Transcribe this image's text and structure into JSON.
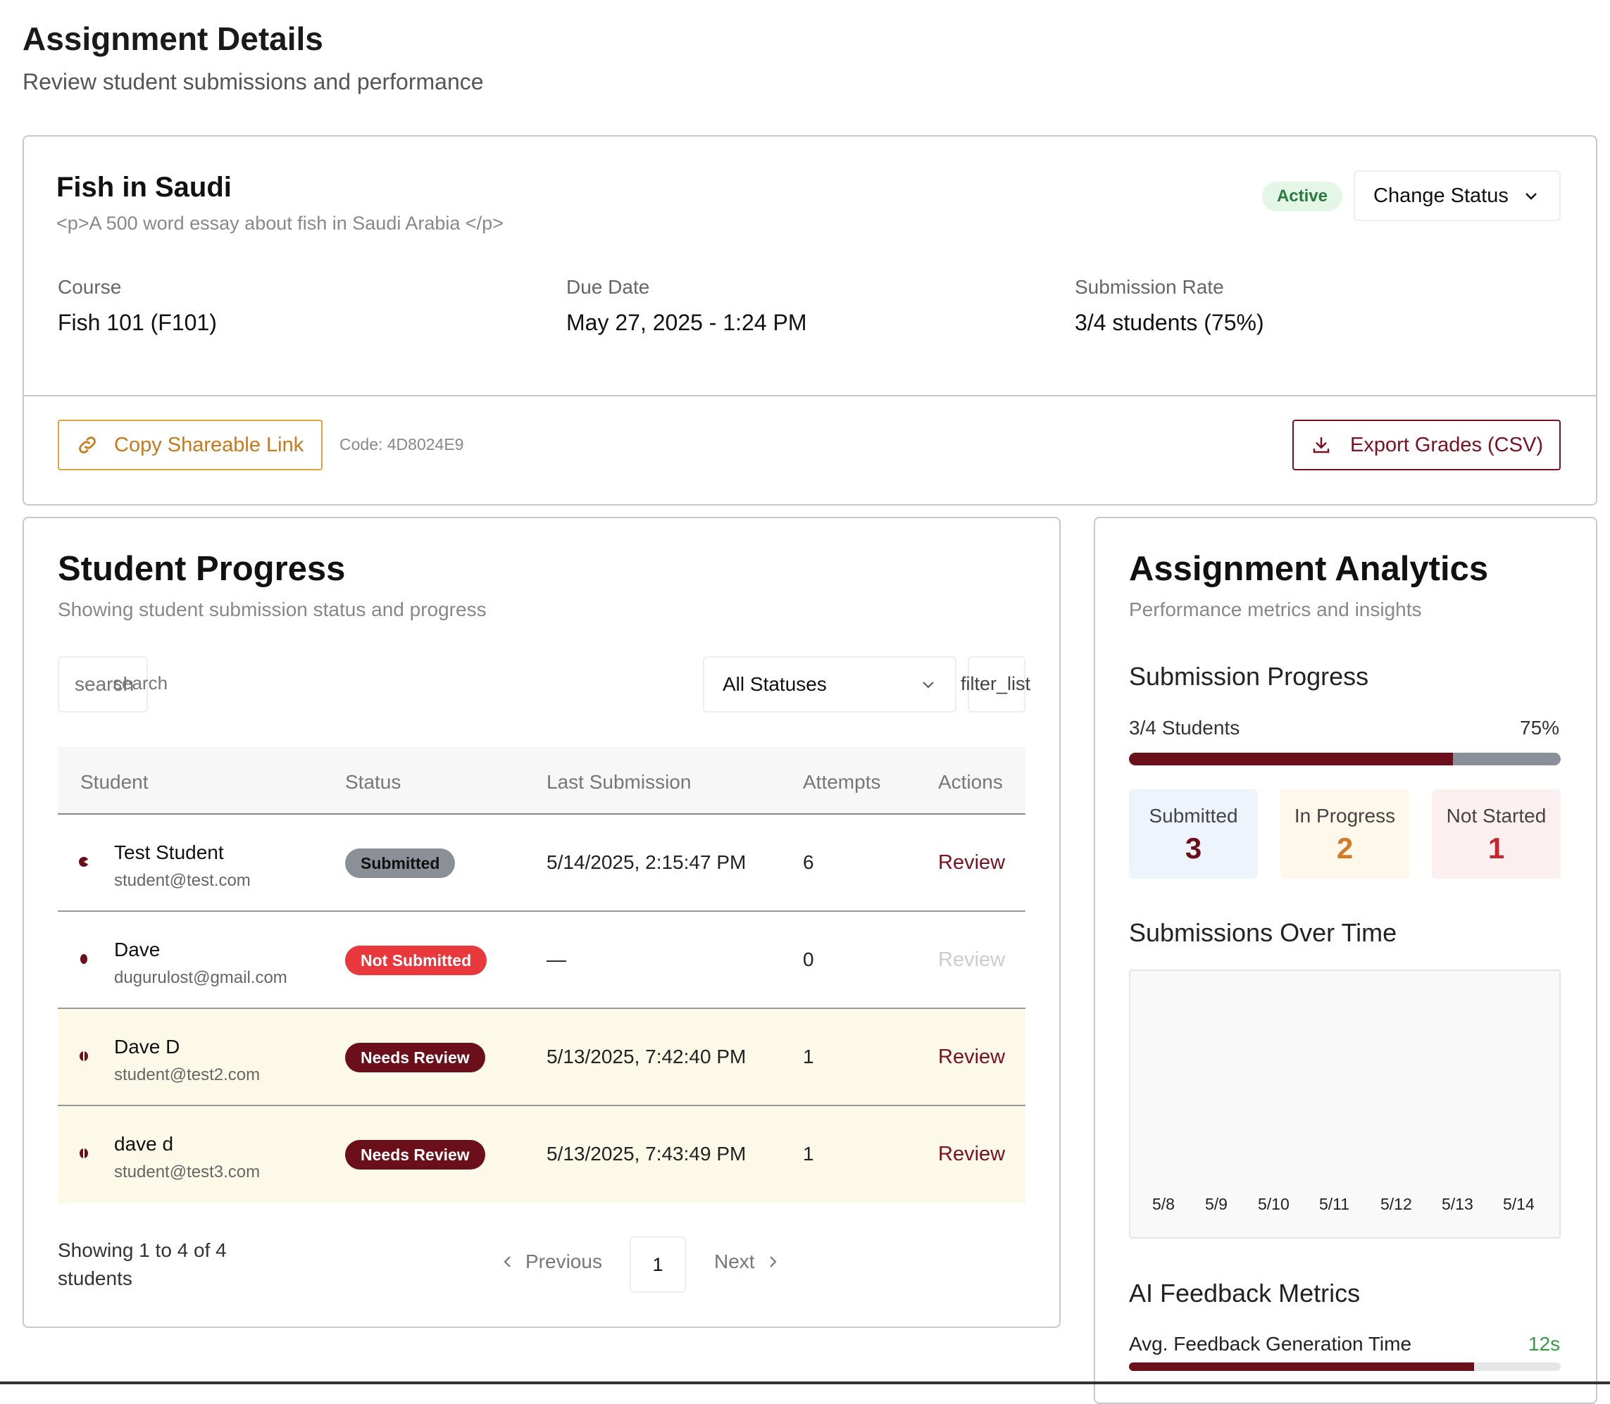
{
  "header": {
    "title": "Assignment Details",
    "subtitle": "Review student submissions and performance"
  },
  "assignment": {
    "title": "Fish in Saudi",
    "description": "<p>A 500 word essay about fish in Saudi Arabia </p>",
    "status_badge": "Active",
    "status_badge_color": "#2b7a3e",
    "change_status_label": "Change Status",
    "course_label": "Course",
    "course_value": "Fish 101 (F101)",
    "due_label": "Due Date",
    "due_value": "May 27, 2025 - 1:24 PM",
    "rate_label": "Submission Rate",
    "rate_value": "3/4 students (75%)",
    "copy_link_label": "Copy Shareable Link",
    "code_text": "Code: 4D8024E9",
    "export_label": "Export Grades (CSV)"
  },
  "progress": {
    "title": "Student Progress",
    "subtitle": "Showing student submission status and progress",
    "search_placeholder": "search",
    "search_icon_text": "search",
    "status_filter_value": "All Statuses",
    "filter_icon_text": "filter_list",
    "columns": [
      "Student",
      "Status",
      "Last Submission",
      "Attempts",
      "Actions"
    ],
    "rows": [
      {
        "name": "Test Student",
        "email": "student@test.com",
        "status": "Submitted",
        "status_color": "#8a8f98",
        "last": "5/14/2025, 2:15:47 PM",
        "attempts": "6",
        "action": "Review"
      },
      {
        "name": "Dave",
        "email": "dugurulost@gmail.com",
        "status": "Not Submitted",
        "status_color": "#e8383b",
        "last": "—",
        "attempts": "0",
        "action": "Review"
      },
      {
        "name": "Dave D",
        "email": "student@test2.com",
        "status": "Needs Review",
        "status_color": "#6b0f1a",
        "last": "5/13/2025, 7:42:40 PM",
        "attempts": "1",
        "action": "Review"
      },
      {
        "name": "dave d",
        "email": "student@test3.com",
        "status": "Needs Review",
        "status_color": "#6b0f1a",
        "last": "5/13/2025, 7:43:49 PM",
        "attempts": "1",
        "action": "Review"
      }
    ],
    "showing_text": "Showing 1 to 4 of 4 students",
    "prev_label": "Previous",
    "page_number": "1",
    "next_label": "Next"
  },
  "analytics": {
    "title": "Assignment Analytics",
    "subtitle": "Performance metrics and insights",
    "submission_progress_title": "Submission Progress",
    "progress_label": "3/4 Students",
    "progress_percent_text": "75%",
    "progress_fraction": 0.75,
    "stats": [
      {
        "label": "Submitted",
        "value": "3",
        "bg": "#eef4fc",
        "color": "#6b0f1a"
      },
      {
        "label": "In Progress",
        "value": "2",
        "bg": "#fdf8ea",
        "color": "#d27a28"
      },
      {
        "label": "Not Started",
        "value": "1",
        "bg": "#fbeff0",
        "color": "#c3262e"
      }
    ],
    "over_time_title": "Submissions Over Time",
    "over_time_ticks": [
      "5/8",
      "5/9",
      "5/10",
      "5/11",
      "5/12",
      "5/13",
      "5/14"
    ],
    "ai_title": "AI Feedback Metrics",
    "feedback_label": "Avg. Feedback Generation Time",
    "feedback_value": "12s",
    "feedback_fraction": 0.8
  },
  "colors": {
    "accent": "#7a1020",
    "copy_accent": "#c9781a"
  }
}
